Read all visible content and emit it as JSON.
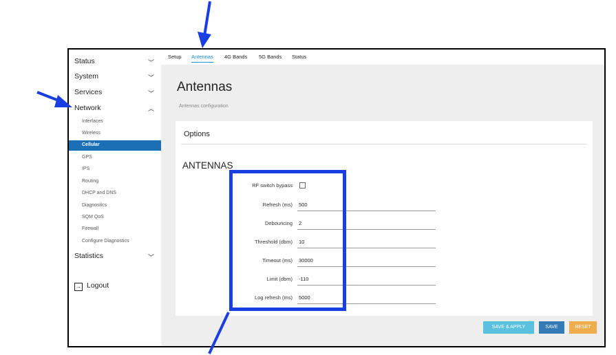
{
  "sidebar": {
    "sections": [
      {
        "label": "Status",
        "icon": "chevron-down-icon",
        "glyph": "﹀"
      },
      {
        "label": "System",
        "icon": "chevron-down-icon",
        "glyph": "﹀"
      },
      {
        "label": "Services",
        "icon": "chevron-down-icon",
        "glyph": "﹀"
      },
      {
        "label": "Network",
        "icon": "chevron-up-icon",
        "glyph": "︿"
      }
    ],
    "network_items": [
      "Interfaces",
      "Wireless",
      "Cellular",
      "GPS",
      "IPS",
      "Routing",
      "DHCP and DNS",
      "Diagnostics",
      "SQM QoS",
      "Firewall",
      "Configure Diagnostics"
    ],
    "active_item": "Cellular",
    "statistics": {
      "label": "Statistics",
      "glyph": "﹀"
    },
    "logout": {
      "label": "Logout",
      "glyph": "→"
    }
  },
  "tabs": [
    "Setup",
    "Antennas",
    "4G Bands",
    "5G Bands",
    "Status"
  ],
  "active_tab": "Antennas",
  "page": {
    "title": "Antennas",
    "subtitle": "Antennas configuration",
    "options_title": "Options",
    "section_title": "ANTENNAS"
  },
  "fields": [
    {
      "label": "RF switch bypass",
      "type": "checkbox",
      "checked": false
    },
    {
      "label": "Refresh (ms)",
      "value": "500"
    },
    {
      "label": "Debouncing",
      "value": "2"
    },
    {
      "label": "Threshold (dbm)",
      "value": "10"
    },
    {
      "label": "Timeout (ms)",
      "value": "30000"
    },
    {
      "label": "Limit (dbm)",
      "value": "-110"
    },
    {
      "label": "Log refresh (ms)",
      "value": "5000"
    }
  ],
  "buttons": {
    "save_apply": "SAVE & APPLY",
    "save": "SAVE",
    "reset": "RESET"
  },
  "colors": {
    "active": "#1a6fb5",
    "tab_active": "#1a8fd6",
    "save_apply": "#5bc0de",
    "save": "#337ab7",
    "reset": "#f0ad4e",
    "annotation": "#1a3fe0"
  }
}
